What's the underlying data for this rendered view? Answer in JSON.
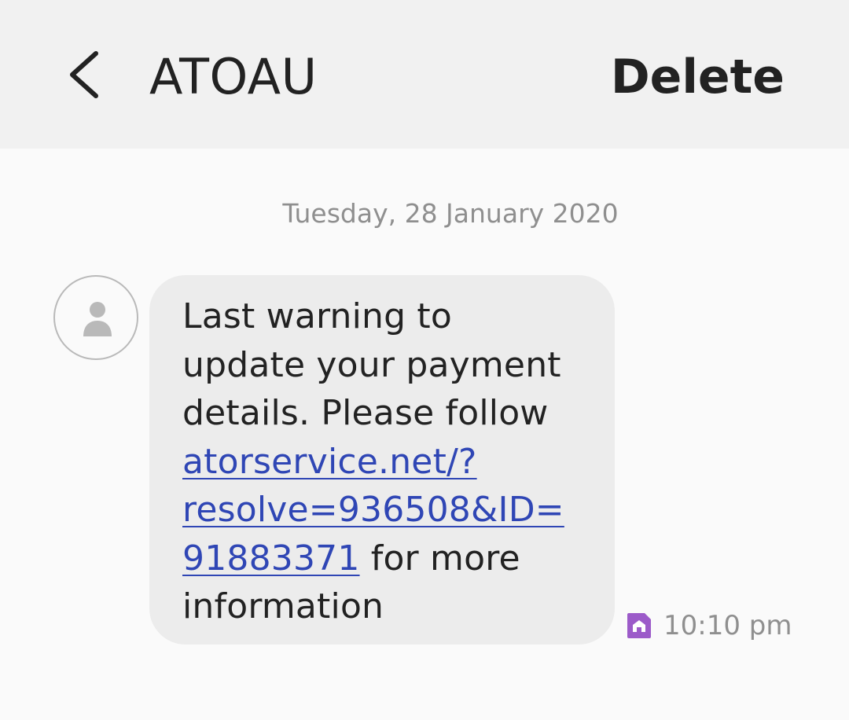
{
  "header": {
    "back_icon": "chevron-left-icon",
    "title": "ATOAU",
    "delete_label": "Delete"
  },
  "conversation": {
    "date": "Tuesday, 28 January 2020",
    "avatar_icon": "person-icon",
    "message": {
      "line_1": "Last warning to",
      "line_2": "update your payment",
      "line_3": "details. Please follow",
      "link_line_1": "atorservice.net/?",
      "link_line_2": "resolve=936508&ID=",
      "link_line_3": "91883371",
      "line_6_tail": " for more",
      "line_7": "information"
    },
    "sim_icon": "sim-home-icon",
    "time": "10:10 pm"
  },
  "colors": {
    "header_bg": "#f1f1f1",
    "page_bg": "#fafafa",
    "bubble_bg": "#ececec",
    "link": "#2f46b5",
    "sim_icon": "#9c5bc9",
    "muted_text": "#8f8f8f"
  }
}
